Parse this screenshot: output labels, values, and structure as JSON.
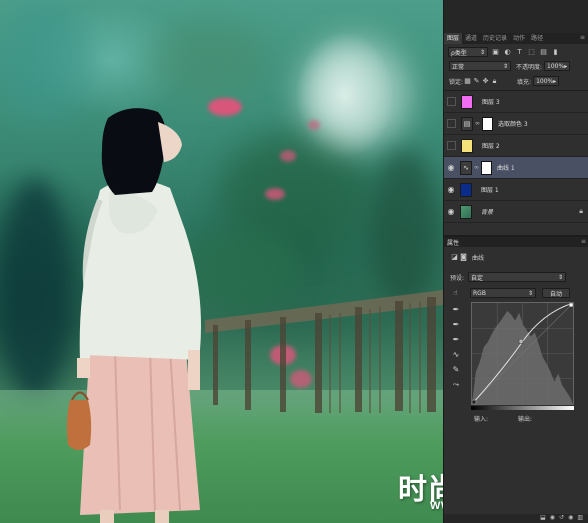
{
  "watermark": {
    "title": "时尚新锋",
    "registered": "®",
    "url": "WWW.SSXF.NET"
  },
  "layers_panel": {
    "tabs": [
      "图层",
      "通道",
      "历史记录",
      "动作",
      "路径"
    ],
    "active_tab": "图层",
    "filter_label": "ρ类型",
    "blend_mode": "正常",
    "opacity_label": "不透明度:",
    "opacity_value": "100%",
    "lock_label": "锁定:",
    "fill_label": "填充:",
    "fill_value": "100%",
    "layers": [
      {
        "name": "图层 3",
        "thumb_color": "#f06cf0",
        "visible": false,
        "has_mask": false,
        "italic": false
      },
      {
        "name": "选取颜色 3",
        "thumb_color": "adjustment",
        "visible": false,
        "has_mask": true,
        "italic": false
      },
      {
        "name": "图层 2",
        "thumb_color": "#f5e27a",
        "visible": false,
        "has_mask": false,
        "italic": false
      },
      {
        "name": "曲线 1",
        "thumb_color": "adjustment",
        "visible": true,
        "has_mask": true,
        "italic": false,
        "selected": true
      },
      {
        "name": "图层 1",
        "thumb_color": "#0c2c8c",
        "visible": true,
        "has_mask": false,
        "italic": false
      },
      {
        "name": "背景",
        "thumb_color": "photo",
        "visible": true,
        "has_mask": false,
        "italic": true,
        "locked": true
      }
    ]
  },
  "properties": {
    "tab": "属性",
    "title": "曲线",
    "preset_label": "预设:",
    "preset_value": "自定",
    "channel": "RGB",
    "auto_label": "自动",
    "input_label": "输入:",
    "output_label": "输出:"
  },
  "icons": {
    "eye": "eye-icon",
    "lock": "lock-icon",
    "chain": "link-icon",
    "eyedropper": "eyedropper-icon",
    "curve_tool": "curve-draw-icon",
    "pencil": "pencil-icon"
  }
}
